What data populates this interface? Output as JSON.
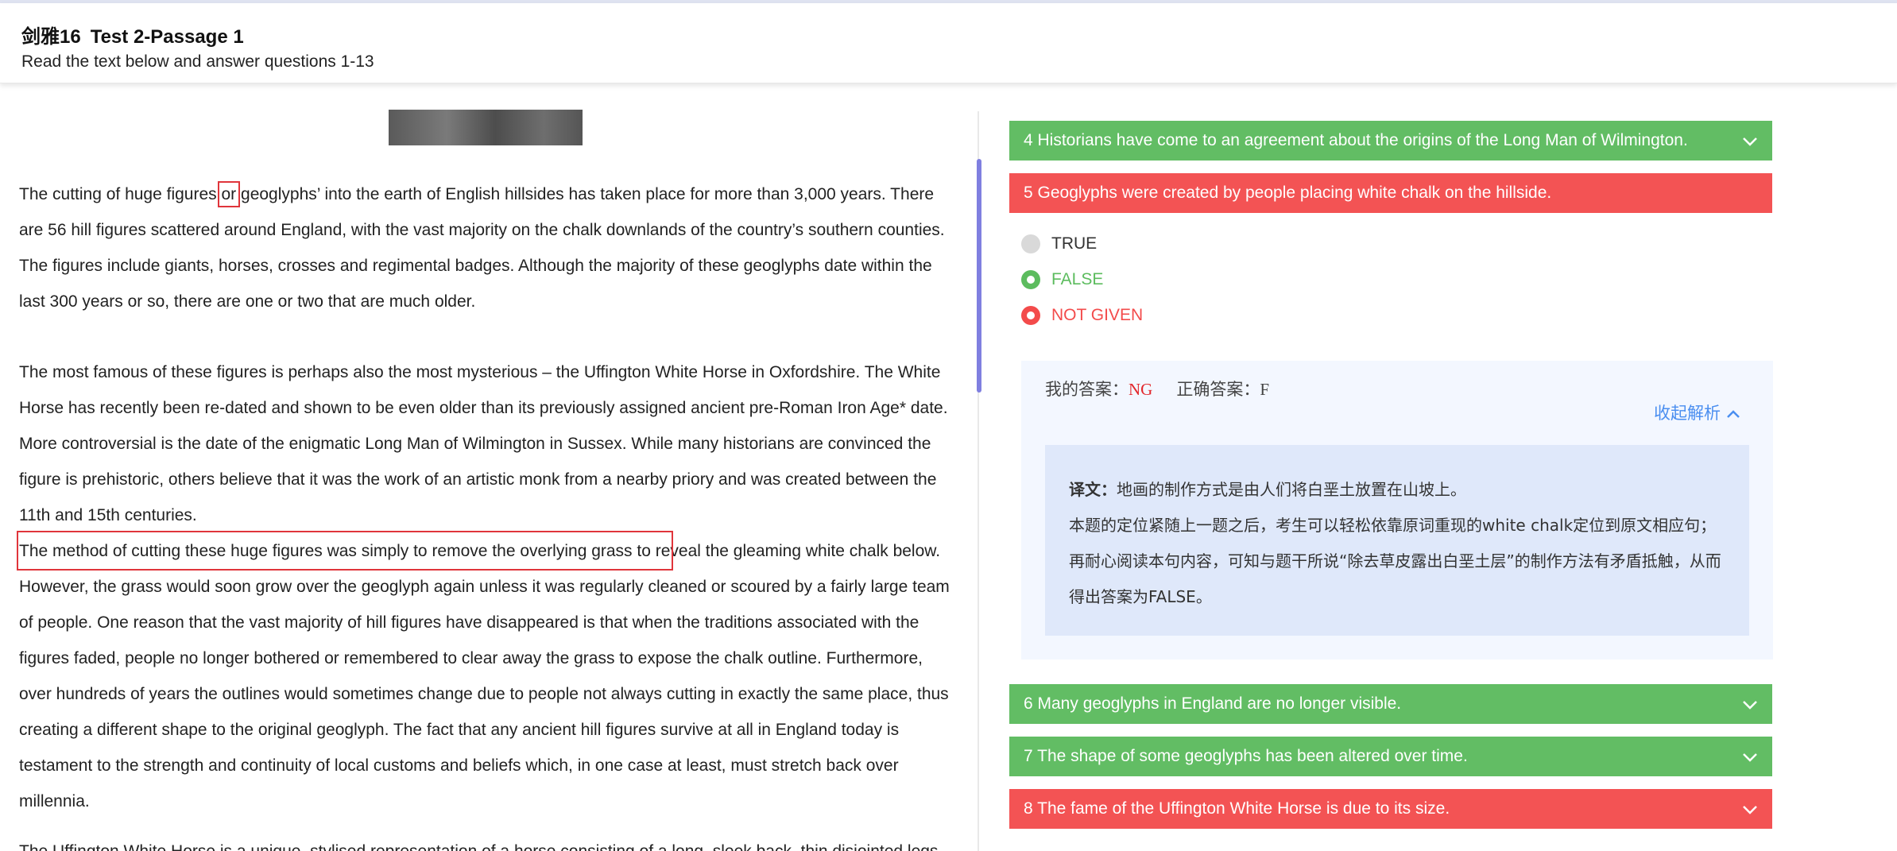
{
  "header": {
    "book": "剑雅16",
    "test": "Test 2-Passage 1",
    "subtitle": "Read the text below and answer questions 1-13"
  },
  "passage": {
    "p1_before": "The cutting of huge figures ",
    "p1_boxed": "or",
    "p1_after": " geoglyphs’ into the earth of English hillsides has taken place for more than 3,000 years. There are 56 hill figures scattered around England, with the vast majority on the chalk downlands of the country’s southern counties. The figures include giants, horses, crosses and regimental badges. Although the majority of these geoglyphs date within the last 300 years or so, there are one or two that are much older.",
    "p2": "The most famous of these figures is perhaps also the most mysterious – the Uffington White Horse in Oxfordshire. The White Horse has recently been re-dated and shown to be even older than its previously assigned ancient pre-Roman Iron Age* date. More controversial is the date of the enigmatic Long Man of Wilmington in Sussex. While many historians are convinced the figure is prehistoric, others believe that it was the work of an artistic monk from a nearby priory and was created between the 11th and 15th centuries.",
    "p3": "The method of cutting these huge figures was simply to remove the overlying grass to reveal the gleaming white chalk below. However, the grass would soon grow over the geoglyph again unless it was regularly cleaned or scoured by a fairly large team of people. One reason that the vast majority of hill figures have disappeared is that when the traditions associated with the figures faded, people no longer bothered or remembered to clear away the grass to expose the chalk outline. Furthermore, over hundreds of years the outlines would sometimes change due to people not always cutting in exactly the same place, thus creating a different shape to the original geoglyph. The fact that any ancient hill figures survive at all in England today is testament to the strength and continuity of local customs and beliefs which, in one case at least, must stretch back over millennia.",
    "p4": "The Uffington White Horse is a unique, stylised representation of a horse consisting of a long, sleek back, thin disjointed legs"
  },
  "questions": [
    {
      "text": "4 Historians have come to an agreement about the origins of the Long Man of Wilmington.",
      "status": "correct"
    },
    {
      "text": "5 Geoglyphs were created by people placing white chalk on the hillside.",
      "status": "wrong"
    },
    {
      "text": "6 Many geoglyphs in England are no longer visible.",
      "status": "correct"
    },
    {
      "text": "7 The shape of some geoglyphs has been altered over time.",
      "status": "correct"
    },
    {
      "text": "8 The fame of the Uffington White Horse is due to its size.",
      "status": "wrong"
    }
  ],
  "options": [
    {
      "label": "TRUE",
      "state": "unselected"
    },
    {
      "label": "FALSE",
      "state": "correct"
    },
    {
      "label": "NOT GIVEN",
      "state": "wrong"
    }
  ],
  "analysis": {
    "my_answer_label": "我的答案：",
    "my_answer": "NG",
    "correct_answer_label": "正确答案：",
    "correct_answer": "F",
    "collapse_label": "收起解析",
    "translation_label": "译文：",
    "translation": "地画的制作方式是由人们将白垩土放置在山坡上。",
    "explanation": "本题的定位紧随上一题之后，考生可以轻松依靠原词重现的white chalk定位到原文相应句；再耐心阅读本句内容，可知与题干所说“除去草皮露出白垩土层”的制作方法有矛盾抵触，从而得出答案为FALSE。"
  },
  "colors": {
    "correct": "#62bd64",
    "wrong": "#f35354",
    "link": "#4a8ef0",
    "highlight_box": "#e0353b",
    "scrollbar": "#7f7fe0"
  }
}
